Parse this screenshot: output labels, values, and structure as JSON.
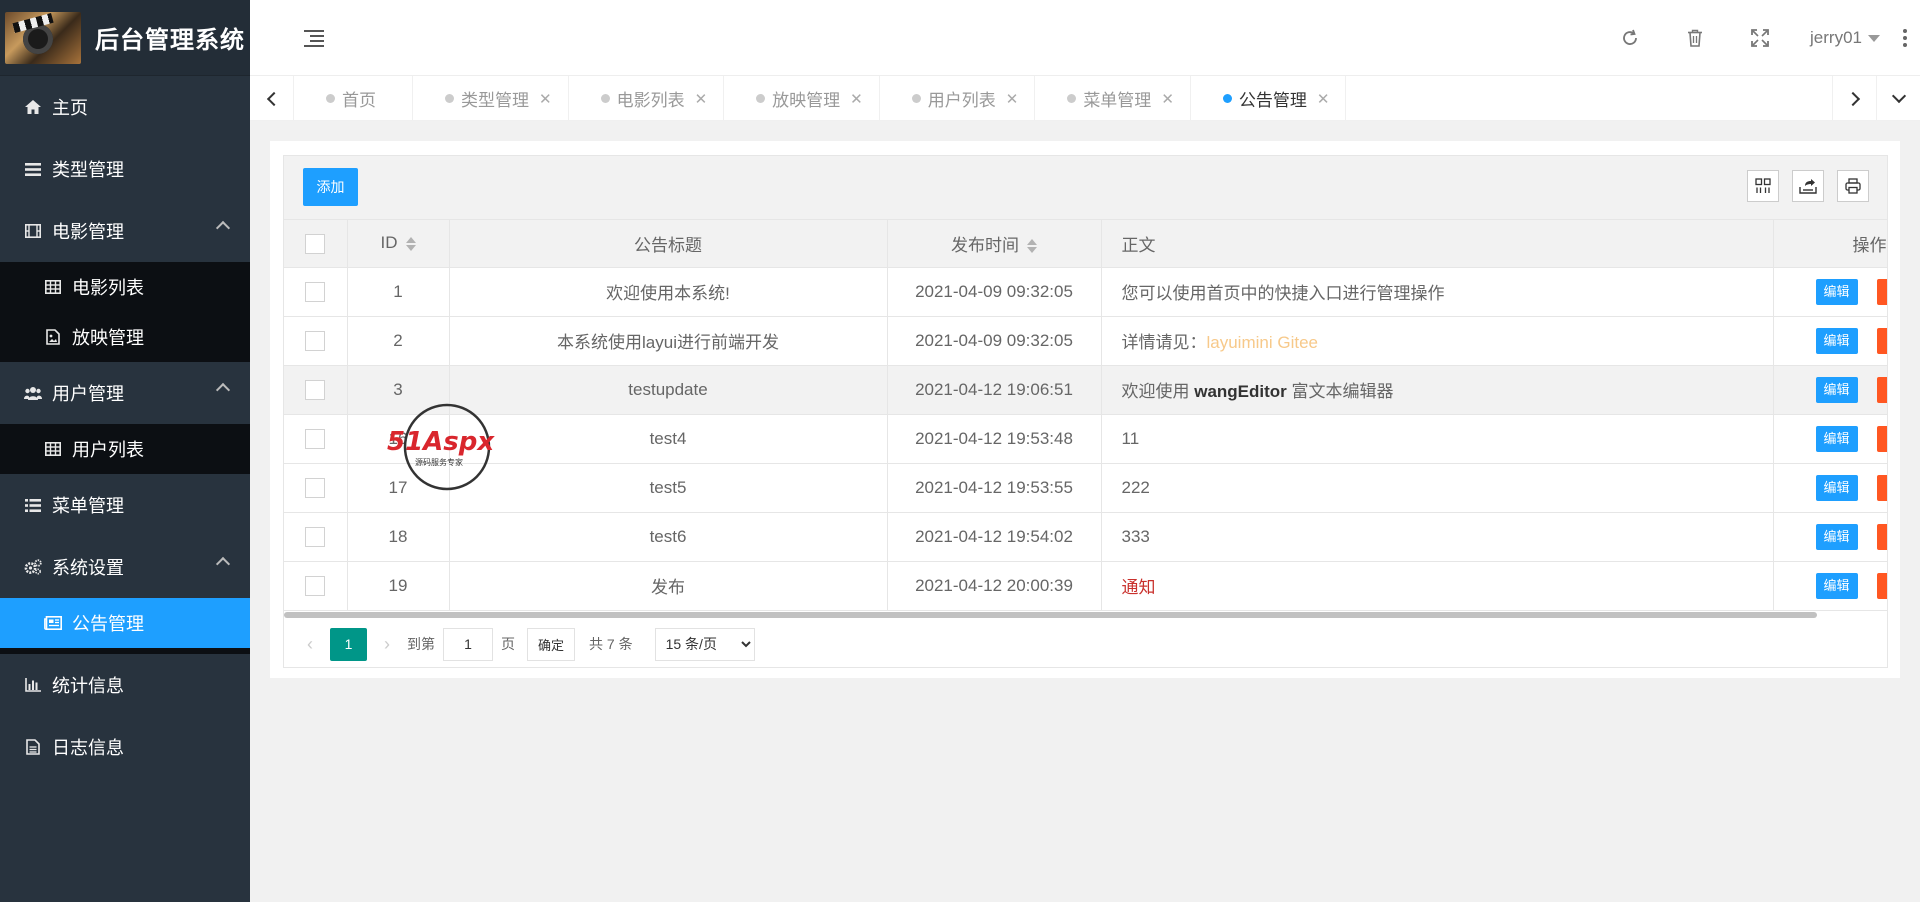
{
  "app": {
    "title": "后台管理系统"
  },
  "sidebar": {
    "items": [
      {
        "label": "主页",
        "icon": "home-icon"
      },
      {
        "label": "类型管理",
        "icon": "list-icon"
      },
      {
        "label": "电影管理",
        "icon": "film-icon",
        "children": [
          {
            "label": "电影列表",
            "icon": "table-icon"
          },
          {
            "label": "放映管理",
            "icon": "file-image-icon"
          }
        ]
      },
      {
        "label": "用户管理",
        "icon": "users-icon",
        "children": [
          {
            "label": "用户列表",
            "icon": "table-icon"
          }
        ]
      },
      {
        "label": "菜单管理",
        "icon": "list-alt-icon"
      },
      {
        "label": "系统设置",
        "icon": "gears-icon",
        "children": [
          {
            "label": "公告管理",
            "icon": "newspaper-icon",
            "active": true
          }
        ]
      },
      {
        "label": "统计信息",
        "icon": "bar-chart-icon"
      },
      {
        "label": "日志信息",
        "icon": "file-text-icon"
      }
    ]
  },
  "header": {
    "user": "jerry01"
  },
  "tabs": [
    {
      "label": "首页",
      "closable": false,
      "active": false
    },
    {
      "label": "类型管理",
      "closable": true,
      "active": false
    },
    {
      "label": "电影列表",
      "closable": true,
      "active": false
    },
    {
      "label": "放映管理",
      "closable": true,
      "active": false
    },
    {
      "label": "用户列表",
      "closable": true,
      "active": false
    },
    {
      "label": "菜单管理",
      "closable": true,
      "active": false
    },
    {
      "label": "公告管理",
      "closable": true,
      "active": true
    }
  ],
  "toolbar": {
    "add_label": "添加"
  },
  "table": {
    "columns": {
      "id": "ID",
      "title": "公告标题",
      "time": "发布时间",
      "body": "正文",
      "op": "操作"
    },
    "edit_label": "编辑",
    "rows": [
      {
        "id": "1",
        "title": "欢迎使用本系统!",
        "time": "2021-04-09 09:32:05",
        "body": "您可以使用首页中的快捷入口进行管理操作"
      },
      {
        "id": "2",
        "title": "本系统使用layui进行前端开发",
        "time": "2021-04-09 09:32:05",
        "body_prefix": "详情请见：",
        "body_link": "layuimini Gitee"
      },
      {
        "id": "3",
        "title": "testupdate",
        "time": "2021-04-12 19:06:51",
        "body_prefix": "欢迎使用 ",
        "body_bold": "wangEditor",
        "body_suffix": " 富文本编辑器"
      },
      {
        "id": "16",
        "title": "test4",
        "time": "2021-04-12 19:53:48",
        "body": "11"
      },
      {
        "id": "17",
        "title": "test5",
        "time": "2021-04-12 19:53:55",
        "body": "222"
      },
      {
        "id": "18",
        "title": "test6",
        "time": "2021-04-12 19:54:02",
        "body": "333"
      },
      {
        "id": "19",
        "title": "发布",
        "time": "2021-04-12 20:00:39",
        "body": "通知"
      }
    ]
  },
  "pager": {
    "current": "1",
    "goto_label": "到第",
    "page_input": "1",
    "page_unit": "页",
    "confirm_label": "确定",
    "total_label": "共 7 条",
    "page_size": "15 条/页"
  },
  "watermark": {
    "text": "51Aspx",
    "subtext": "源码服务专家"
  },
  "colors": {
    "sidebar": "#28333e",
    "accent": "#1e9fff",
    "pager_active": "#009688",
    "danger": "#ff5722"
  }
}
